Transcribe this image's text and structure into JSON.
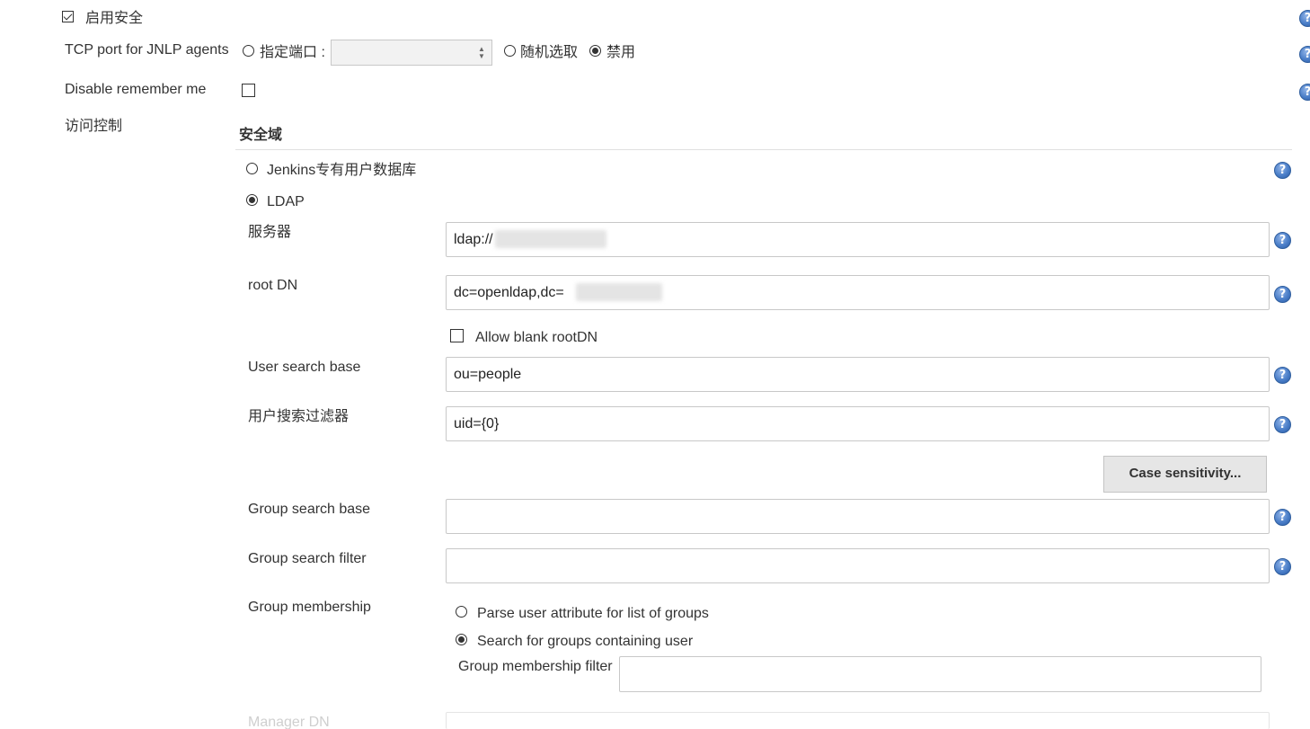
{
  "enable_security": {
    "label": "启用安全",
    "checked": true
  },
  "jnlp": {
    "label": "TCP port for JNLP agents",
    "options": [
      {
        "label": "指定端口 :",
        "selected": false
      },
      {
        "label": "随机选取",
        "selected": false
      },
      {
        "label": "禁用",
        "selected": true
      }
    ],
    "port_value": ""
  },
  "disable_remember_me": {
    "label": "Disable remember me",
    "checked": false
  },
  "access_control": {
    "label": "访问控制"
  },
  "security_realm": {
    "heading": "安全域",
    "options": [
      {
        "label": "Jenkins专有用户数据库",
        "selected": false
      },
      {
        "label": "LDAP",
        "selected": true
      }
    ]
  },
  "ldap": {
    "server": {
      "label": "服务器",
      "value": "ldap://"
    },
    "root_dn": {
      "label": "root DN",
      "value": "dc=openldap,dc="
    },
    "allow_blank_root_dn": {
      "label": "Allow blank rootDN",
      "checked": false
    },
    "user_search_base": {
      "label": "User search base",
      "value": "ou=people"
    },
    "user_search_filter": {
      "label": "用户搜索过滤器",
      "value": "uid={0}"
    },
    "case_sensitivity_button": "Case sensitivity...",
    "group_search_base": {
      "label": "Group search base",
      "value": ""
    },
    "group_search_filter": {
      "label": "Group search filter",
      "value": ""
    },
    "group_membership": {
      "label": "Group membership",
      "options": [
        {
          "label": "Parse user attribute for list of groups",
          "selected": false
        },
        {
          "label": "Search for groups containing user",
          "selected": true
        }
      ],
      "filter_label": "Group membership filter",
      "filter_value": ""
    },
    "manager_dn": {
      "label": "Manager DN"
    }
  },
  "help_icon_glyph": "?",
  "colors": {
    "help_blue": "#4a7ec8",
    "button_gray": "#e6e6e6",
    "border": "#c8c8c8"
  }
}
